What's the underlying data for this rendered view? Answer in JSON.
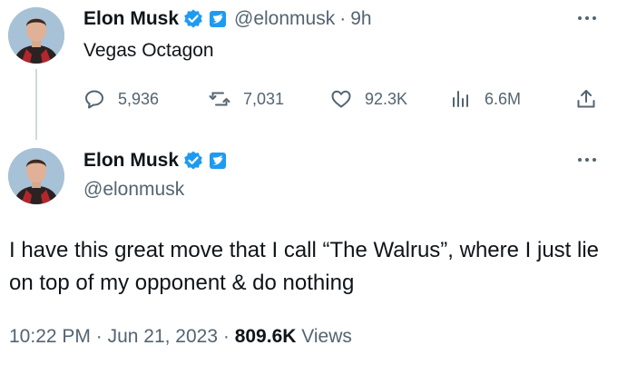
{
  "reply_tweet": {
    "author": {
      "name": "Elon Musk",
      "handle": "@elonmusk"
    },
    "time_ago": "9h",
    "separator": "·",
    "text": "Vegas Octagon",
    "stats": {
      "replies": "5,936",
      "reposts": "7,031",
      "likes": "92.3K",
      "views": "6.6M"
    }
  },
  "main_tweet": {
    "author": {
      "name": "Elon Musk",
      "handle": "@elonmusk"
    },
    "text": "I have this great move that I call “The Walrus”, where I just lie on top of my opponent & do nothing",
    "time": "10:22 PM",
    "separator": "·",
    "date": "Jun 21, 2023",
    "views_count": "809.6K",
    "views_label": "Views"
  },
  "icons": {
    "verified": "verified-badge-icon",
    "affiliate": "x-affiliate-badge-icon",
    "more": "more-dots-icon",
    "reply": "reply-bubble-icon",
    "repost": "repost-icon",
    "like": "heart-icon",
    "views": "views-bars-icon",
    "share": "share-upload-icon"
  },
  "colors": {
    "text_primary": "#0f1419",
    "text_secondary": "#536471",
    "verified_blue": "#1d9bf0",
    "thread_line": "#cfd9de"
  }
}
